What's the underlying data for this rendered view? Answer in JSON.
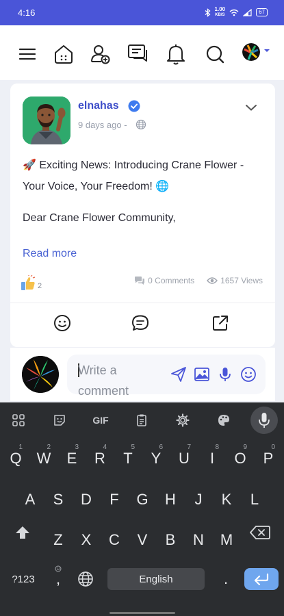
{
  "status_bar": {
    "time": "4:16",
    "net_speed_top": "1.00",
    "net_speed_bottom": "KB/S",
    "battery": "67"
  },
  "nav": {
    "icons": [
      "menu-icon",
      "home-icon",
      "add-friend-icon",
      "messages-icon",
      "bell-icon",
      "search-icon"
    ]
  },
  "post": {
    "author": "elnahas",
    "time_ago": "9 days ago -",
    "title": "🚀 Exciting News: Introducing Crane Flower - Your Voice, Your Freedom! 🌐",
    "salutation": "Dear Crane Flower Community,",
    "read_more": "Read more",
    "reaction_count": "2",
    "comments": "0 Comments",
    "views": "1657 Views"
  },
  "comment": {
    "placeholder": "Write a comment"
  },
  "keyboard": {
    "gif_label": "GIF",
    "row1": [
      {
        "k": "Q",
        "n": "1"
      },
      {
        "k": "W",
        "n": "2"
      },
      {
        "k": "E",
        "n": "3"
      },
      {
        "k": "R",
        "n": "4"
      },
      {
        "k": "T",
        "n": "5"
      },
      {
        "k": "Y",
        "n": "6"
      },
      {
        "k": "U",
        "n": "7"
      },
      {
        "k": "I",
        "n": "8"
      },
      {
        "k": "O",
        "n": "9"
      },
      {
        "k": "P",
        "n": "0"
      }
    ],
    "row2": [
      "A",
      "S",
      "D",
      "F",
      "G",
      "H",
      "J",
      "K",
      "L"
    ],
    "row3": [
      "Z",
      "X",
      "C",
      "V",
      "B",
      "N",
      "M"
    ],
    "sym_label": "?123",
    "comma": ",",
    "space_label": "English",
    "period": "."
  },
  "colors": {
    "brand": "#4a55d8",
    "link": "#4a63d3",
    "author": "#3e4ec9",
    "keyboard_bg": "#2b2d30"
  }
}
